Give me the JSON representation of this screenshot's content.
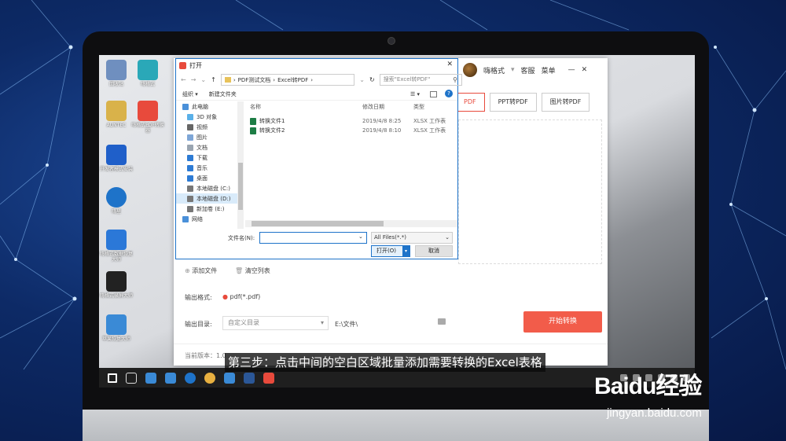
{
  "desktop_icons": [
    {
      "label": "回收站",
      "color": "#6f8fbf"
    },
    {
      "label": "嗨格式",
      "color": "#2aa8b8"
    },
    {
      "label": "AUNTEC",
      "color": "#d9b24a"
    },
    {
      "label": "嗨格式PDF转换器",
      "color": "#e84a3c"
    },
    {
      "label": "开发者模式安装",
      "color": "#1f5fc9"
    },
    {
      "label": "嗨星",
      "color": "#1e73c9"
    },
    {
      "label": "嗨格式数据恢复大师",
      "color": "#2b78d8"
    },
    {
      "label": "嗨格式录屏大师",
      "color": "#222222"
    },
    {
      "label": "苹果恢复大师",
      "color": "#3a8ad6"
    }
  ],
  "app": {
    "username": "嗨格式",
    "service": "客服",
    "menu": "菜单",
    "tabs": [
      "PDF",
      "PPT转PDF",
      "图片转PDF"
    ],
    "add_file": "添加文件",
    "clear_list": "清空列表",
    "output_format_label": "输出格式:",
    "output_format_value": "pdf(*.pdf)",
    "output_dir_label": "输出目录:",
    "output_dir_select": "自定义目录",
    "output_dir_path": "E:\\文件\\",
    "start_button": "开始转换",
    "version_label": "当前版本：1.0"
  },
  "dialog": {
    "title": "打开",
    "breadcrumb": [
      "PDF测试文档",
      "Excel转PDF"
    ],
    "search_placeholder": "搜索\"Excel转PDF\"",
    "organize": "组织 ▾",
    "new_folder": "新建文件夹",
    "tree": [
      {
        "label": "此电脑",
        "color": "#4a90d9"
      },
      {
        "label": "3D 对象",
        "color": "#5ab0e8"
      },
      {
        "label": "视频",
        "color": "#666666"
      },
      {
        "label": "图片",
        "color": "#7ea6d6"
      },
      {
        "label": "文档",
        "color": "#9aa5b1"
      },
      {
        "label": "下载",
        "color": "#2d7bd4"
      },
      {
        "label": "音乐",
        "color": "#2d7bd4"
      },
      {
        "label": "桌面",
        "color": "#2d7bd4"
      },
      {
        "label": "本地磁盘 (C:)",
        "color": "#777777"
      },
      {
        "label": "本地磁盘 (D:)",
        "color": "#777777"
      },
      {
        "label": "新加卷 (E:)",
        "color": "#777777"
      },
      {
        "label": "网络",
        "color": "#4a90d9"
      }
    ],
    "selected_tree_index": 9,
    "columns": [
      "名称",
      "修改日期",
      "类型"
    ],
    "files": [
      {
        "name": "转换文件1",
        "date": "2019/4/8 8:25",
        "type": "XLSX 工作表"
      },
      {
        "name": "转换文件2",
        "date": "2019/4/8 8:10",
        "type": "XLSX 工作表"
      }
    ],
    "filename_label": "文件名(N):",
    "filename_value": "",
    "filter": "All Files(*.*)",
    "open_button": "打开(O)",
    "cancel_button": "取消"
  },
  "subtitle": "第三步：点击中间的空白区域批量添加需要转换的Excel表格",
  "taskbar_icons": [
    {
      "name": "start-icon",
      "color": "#ffffff"
    },
    {
      "name": "task-view-icon",
      "color": "#dddddd"
    },
    {
      "name": "app-icon-1",
      "color": "#3a8ad6"
    },
    {
      "name": "app-icon-2",
      "color": "#3a8ad6"
    },
    {
      "name": "edge-icon",
      "color": "#1e73c9"
    },
    {
      "name": "chrome-icon",
      "color": "#e8b040"
    },
    {
      "name": "app-icon-3",
      "color": "#3a8ad6"
    },
    {
      "name": "word-icon",
      "color": "#2b5797"
    },
    {
      "name": "pdf-app-icon",
      "color": "#e84a3c"
    }
  ],
  "watermark": {
    "brand": "Baidu经验",
    "url": "jingyan.baidu.com"
  }
}
